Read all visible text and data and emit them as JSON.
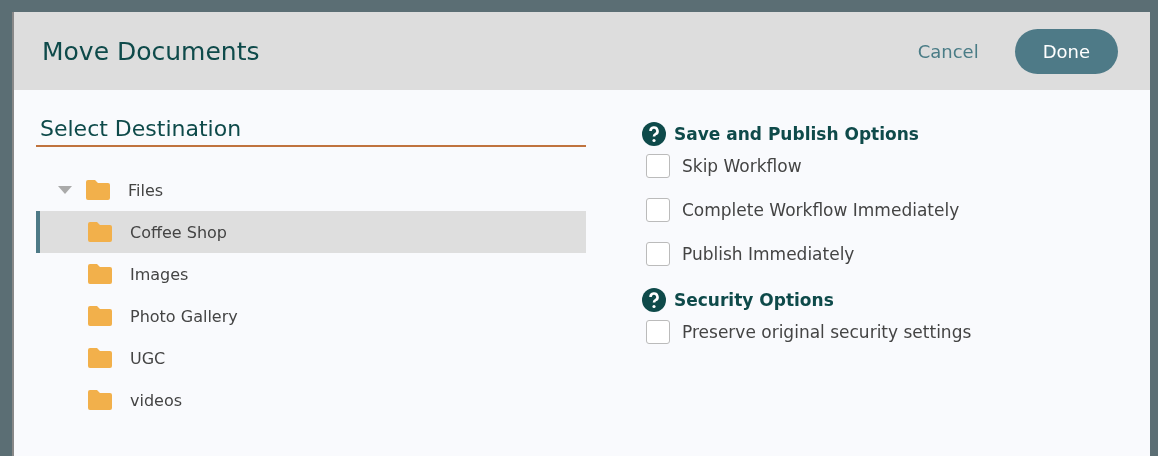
{
  "dialog": {
    "title": "Move Documents",
    "buttons": [
      {
        "label": "Cancel",
        "kind": "link"
      },
      {
        "label": "Done",
        "kind": "primary"
      }
    ]
  },
  "destination": {
    "title": "Select Destination",
    "tree": [
      {
        "label": "Files",
        "expanded": true,
        "selected": false,
        "children": [
          {
            "label": "Coffee Shop",
            "selected": true
          },
          {
            "label": "Images",
            "selected": false
          },
          {
            "label": "Photo Gallery",
            "selected": false
          },
          {
            "label": "UGC",
            "selected": false
          },
          {
            "label": "videos",
            "selected": false
          }
        ]
      }
    ]
  },
  "option_groups": [
    {
      "title": "Save and Publish Options",
      "options": [
        {
          "label": "Skip Workflow",
          "checked": false
        },
        {
          "label": "Complete Workflow Immediately",
          "checked": false
        },
        {
          "label": "Publish Immediately",
          "checked": false
        }
      ]
    },
    {
      "title": "Security Options",
      "options": [
        {
          "label": "Preserve original security settings",
          "checked": false
        }
      ]
    }
  ]
}
